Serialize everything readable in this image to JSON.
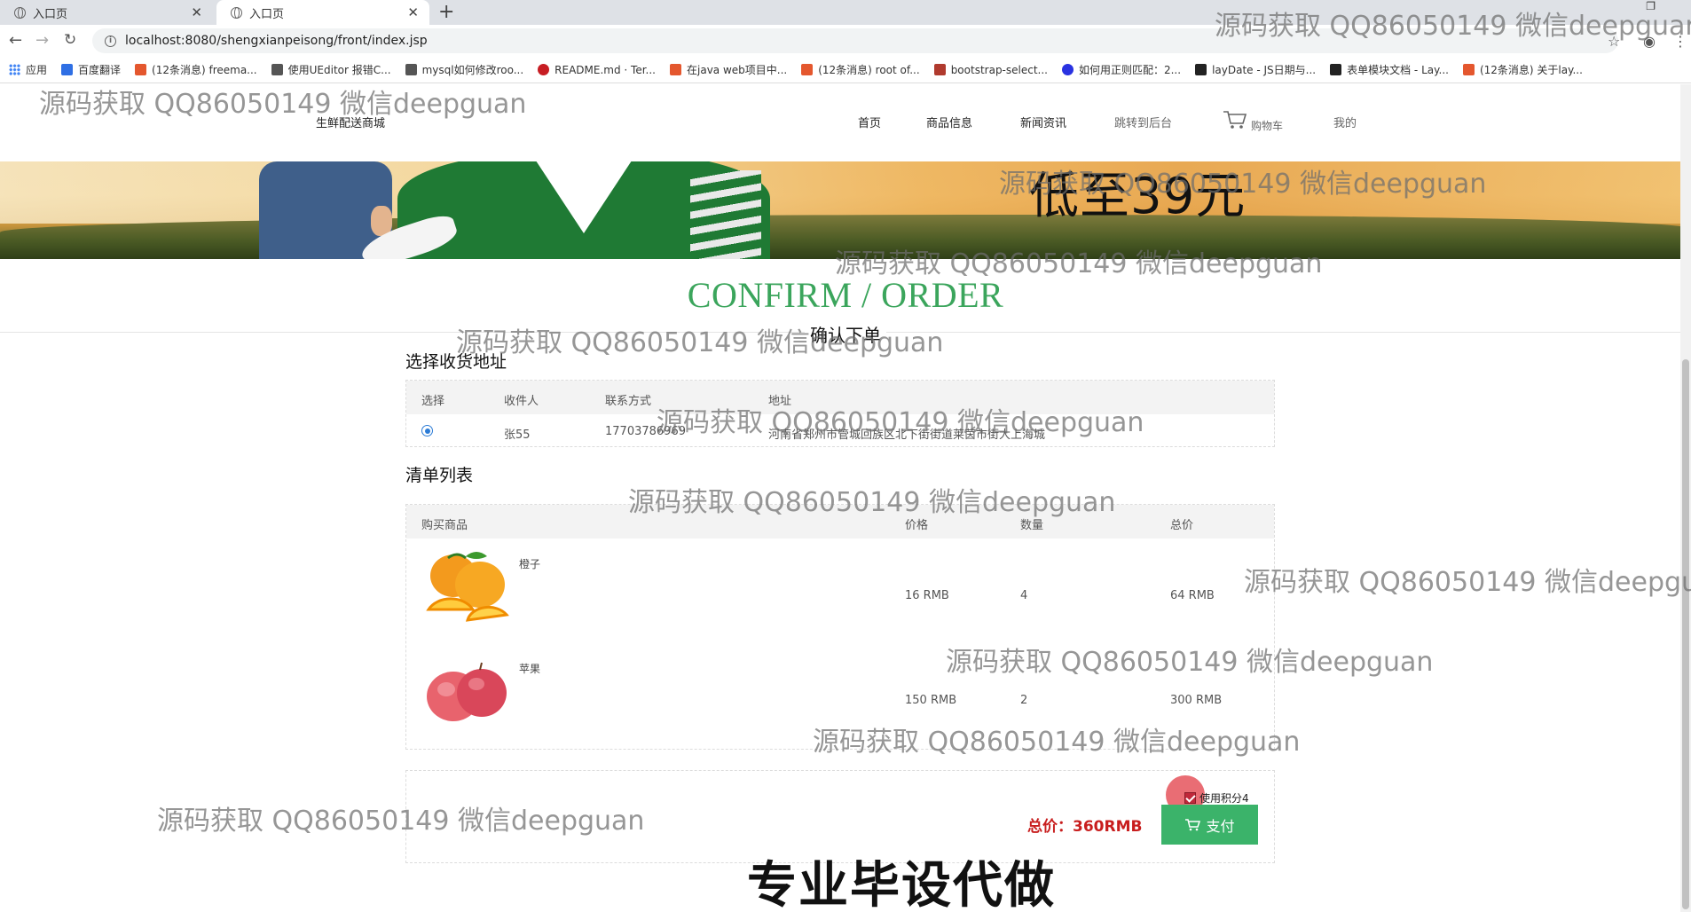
{
  "browser": {
    "tabs": [
      {
        "title": "入口页",
        "active": false
      },
      {
        "title": "入口页",
        "active": true
      }
    ],
    "url": "localhost:8080/shengxianpeisong/front/index.jsp",
    "bookmarks": [
      {
        "label": "应用",
        "icon": "apps-grid-icon",
        "color": "#4285f4"
      },
      {
        "label": "百度翻译",
        "icon": "baidu-translate-icon",
        "color": "#2f6fe4"
      },
      {
        "label": "(12条消息) freema...",
        "icon": "csdn-icon",
        "color": "#e4572e"
      },
      {
        "label": "使用UEditor 报错C...",
        "icon": "ueditor-icon",
        "color": "#555555"
      },
      {
        "label": "mysql如何修改roo...",
        "icon": "ueditor-icon",
        "color": "#555555"
      },
      {
        "label": "README.md · Ter...",
        "icon": "gitee-icon",
        "color": "#c71d23"
      },
      {
        "label": "在java web项目中...",
        "icon": "csdn-icon",
        "color": "#e4572e"
      },
      {
        "label": "(12条消息) root of...",
        "icon": "csdn-icon",
        "color": "#e4572e"
      },
      {
        "label": "bootstrap-select...",
        "icon": "bootstrap-icon",
        "color": "#b03a2e"
      },
      {
        "label": "如何用正则匹配：2...",
        "icon": "baidu-icon",
        "color": "#2932e1"
      },
      {
        "label": "layDate - JS日期与...",
        "icon": "layui-icon",
        "color": "#222222"
      },
      {
        "label": "表单模块文档 - Lay...",
        "icon": "layui-icon",
        "color": "#222222"
      },
      {
        "label": "(12条消息) 关于lay...",
        "icon": "csdn-icon",
        "color": "#e4572e"
      }
    ]
  },
  "site": {
    "brand": "生鲜配送商城",
    "nav": [
      "首页",
      "商品信息",
      "新闻资讯",
      "跳转到后台",
      "购物车",
      "我的"
    ],
    "banner_text": "低至39元"
  },
  "order": {
    "title_en": "CONFIRM / ORDER",
    "title_cn": "确认下单",
    "address_heading": "选择收货地址",
    "address_columns": [
      "选择",
      "收件人",
      "联系方式",
      "地址"
    ],
    "address_rows": [
      {
        "selected": true,
        "name": "张55",
        "phone": "17703786969",
        "address": "河南省郑州市管城回族区北下街街道莱茵市街大上海城"
      }
    ],
    "list_heading": "清单列表",
    "item_columns": [
      "购买商品",
      "价格",
      "数量",
      "总价"
    ],
    "items": [
      {
        "name": "橙子",
        "price": "16 RMB",
        "qty": "4",
        "total": "64 RMB",
        "image": "orange-image"
      },
      {
        "name": "苹果",
        "price": "150 RMB",
        "qty": "2",
        "total": "300 RMB",
        "image": "apple-image"
      }
    ],
    "use_points_label": "使用积分4",
    "use_points_checked": true,
    "total_label": "总价：360RMB",
    "pay_label": "支付"
  },
  "watermarks": [
    "源码获取 QQ86050149 微信deepguan",
    "专业毕设代做"
  ],
  "colors": {
    "accent_green": "#3ba55c",
    "pay_green": "#3bb36a",
    "total_red": "#c81e1e"
  }
}
